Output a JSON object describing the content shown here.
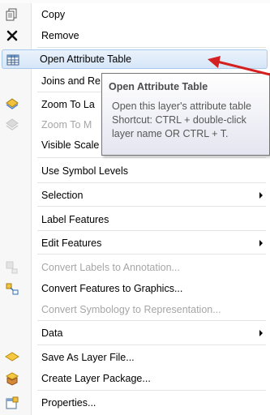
{
  "menu": {
    "items": [
      {
        "label": "Copy",
        "icon": "copy-icon"
      },
      {
        "label": "Remove",
        "icon": "remove-icon"
      },
      {
        "label": "Open Attribute Table",
        "icon": "table-icon",
        "highlighted": true
      },
      {
        "label": "Joins and Relates",
        "visible_label": "Joins and Re"
      },
      {
        "label": "Zoom To Layer",
        "visible_label": "Zoom To La",
        "icon": "zoom-to-layer-icon"
      },
      {
        "label": "Zoom To Make Visible",
        "visible_label": "Zoom To M",
        "icon": "zoom-to-make-visible-icon",
        "disabled": true
      },
      {
        "label": "Visible Scale Range",
        "visible_label": "Visible Scale"
      },
      {
        "label": "Use Symbol Levels"
      },
      {
        "label": "Selection",
        "submenu": true
      },
      {
        "label": "Label Features"
      },
      {
        "label": "Edit Features",
        "submenu": true
      },
      {
        "label": "Convert Labels to Annotation...",
        "icon": "convert-labels-icon",
        "disabled": true
      },
      {
        "label": "Convert Features to Graphics...",
        "icon": "convert-features-icon"
      },
      {
        "label": "Convert Symbology to Representation...",
        "disabled": true
      },
      {
        "label": "Data",
        "submenu": true
      },
      {
        "label": "Save As Layer File...",
        "icon": "save-layer-icon"
      },
      {
        "label": "Create Layer Package...",
        "icon": "layer-package-icon"
      },
      {
        "label": "Properties...",
        "icon": "properties-icon"
      }
    ]
  },
  "tooltip": {
    "title": "Open Attribute Table",
    "body": "Open this layer's attribute table\nShortcut: CTRL + double-click\nlayer name OR CTRL + T."
  },
  "annotation": {
    "arrow_color": "#d42020"
  },
  "colors": {
    "highlight": "#d6e6f8",
    "disabled_text": "#a6a6a6"
  }
}
